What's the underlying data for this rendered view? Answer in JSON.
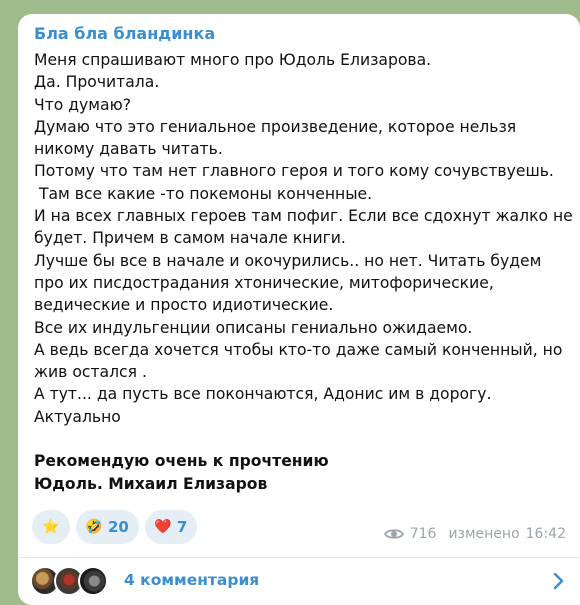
{
  "channel": {
    "name": "Бла бла бландинка"
  },
  "message": {
    "lines": [
      "Меня спрашивают много про Юдоль  Елизарова.",
      "Да. Прочитала.",
      "Что думаю?",
      "Думаю что это гениальное произведение, которое нельзя",
      "никому давать читать.",
      "Потому что там нет главного героя и того кому сочувствуешь.",
      " Там все какие -то покемоны конченные.",
      "И на всех главных героев там пофиг. Если все сдохнут жалко не",
      "будет. Причем в самом начале книги.",
      "Лучше бы все в начале и окочурились.. но нет. Читать будем",
      "про их писдострадания хтонические, митофорические,",
      "ведические и просто идиотические.",
      "Все их индульгенции описаны гениально ожидаемо.",
      "А ведь всегда хочется чтобы кто-то даже самый конченный, но",
      "жив остался .",
      "А тут... да пусть все покончаются, Адонис им в дорогу.",
      "Актуально"
    ],
    "bold_lines": [
      "Рекомендую очень к прочтению",
      "Юдоль. Михаил Елизаров"
    ]
  },
  "reactions": [
    {
      "emoji": "⭐",
      "icon": "star-icon",
      "count": ""
    },
    {
      "emoji": "🤣",
      "icon": "rofl-icon",
      "count": "20"
    },
    {
      "emoji": "❤️",
      "icon": "heart-icon",
      "count": "7"
    }
  ],
  "meta": {
    "views": "716",
    "edited_label": "изменено",
    "time": "16:42"
  },
  "comments": {
    "label": "4 комментария"
  },
  "colors": {
    "accent": "#3a8fd0",
    "meta": "#9aa5ad",
    "reaction_bg": "#e6eef5",
    "background": "#9ebb8b"
  }
}
